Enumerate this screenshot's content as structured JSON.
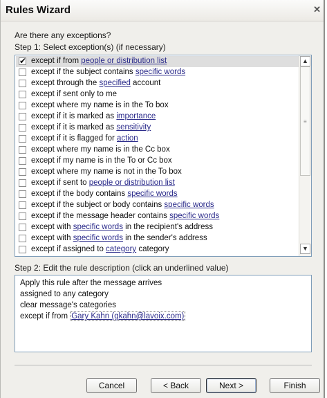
{
  "window": {
    "title": "Rules Wizard",
    "close_glyph": "✕"
  },
  "prompt": "Are there any exceptions?",
  "step1_label": "Step 1: Select exception(s) (if necessary)",
  "conditions": [
    {
      "checked": true,
      "pre": "except if from ",
      "link": "people or distribution list",
      "post": ""
    },
    {
      "checked": false,
      "pre": "except if the subject contains ",
      "link": "specific words",
      "post": ""
    },
    {
      "checked": false,
      "pre": "except through the ",
      "link": "specified",
      "post": " account"
    },
    {
      "checked": false,
      "pre": "except if sent only to me",
      "link": "",
      "post": ""
    },
    {
      "checked": false,
      "pre": "except where my name is in the To box",
      "link": "",
      "post": ""
    },
    {
      "checked": false,
      "pre": "except if it is marked as ",
      "link": "importance",
      "post": ""
    },
    {
      "checked": false,
      "pre": "except if it is marked as ",
      "link": "sensitivity",
      "post": ""
    },
    {
      "checked": false,
      "pre": "except if it is flagged for ",
      "link": "action",
      "post": ""
    },
    {
      "checked": false,
      "pre": "except where my name is in the Cc box",
      "link": "",
      "post": ""
    },
    {
      "checked": false,
      "pre": "except if my name is in the To or Cc box",
      "link": "",
      "post": ""
    },
    {
      "checked": false,
      "pre": "except where my name is not in the To box",
      "link": "",
      "post": ""
    },
    {
      "checked": false,
      "pre": "except if sent to ",
      "link": "people or distribution list",
      "post": ""
    },
    {
      "checked": false,
      "pre": "except if the body contains ",
      "link": "specific words",
      "post": ""
    },
    {
      "checked": false,
      "pre": "except if the subject or body contains ",
      "link": "specific words",
      "post": ""
    },
    {
      "checked": false,
      "pre": "except if the message header contains ",
      "link": "specific words",
      "post": ""
    },
    {
      "checked": false,
      "pre": "except with ",
      "link": "specific words",
      "post": " in the recipient's address"
    },
    {
      "checked": false,
      "pre": "except with ",
      "link": "specific words",
      "post": " in the sender's address"
    },
    {
      "checked": false,
      "pre": "except if assigned to ",
      "link": "category",
      "post": " category"
    }
  ],
  "step2_label": "Step 2: Edit the rule description (click an underlined value)",
  "description": {
    "line1": "Apply this rule after the message arrives",
    "line2": "assigned to any category",
    "line3": "clear message's categories",
    "line4_pre": "except if from ",
    "line4_link": "Gary Kahn (gkahn@lavoix.com)"
  },
  "buttons": {
    "cancel": "Cancel",
    "back": "< Back",
    "next": "Next >",
    "finish": "Finish"
  },
  "scroll": {
    "up_glyph": "▲",
    "down_glyph": "▼",
    "grip_glyph": "≡",
    "position": 0.0
  },
  "check_glyph": "✔"
}
